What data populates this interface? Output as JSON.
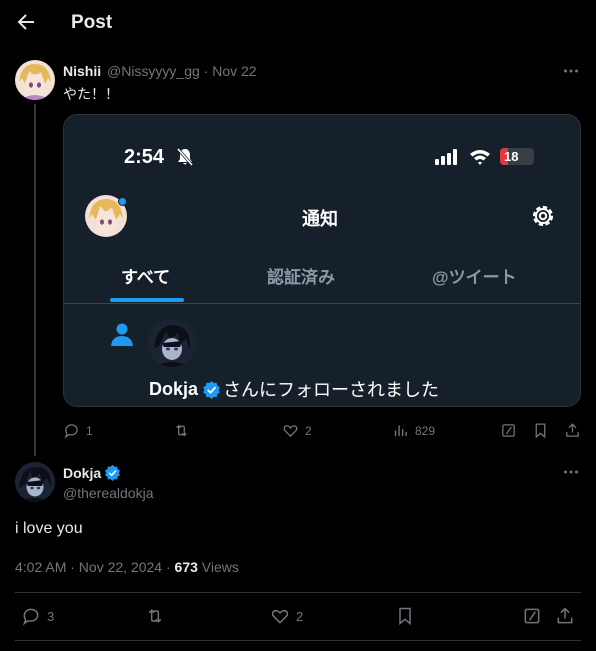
{
  "header": {
    "title": "Post"
  },
  "tweet1": {
    "name": "Nishii",
    "handle": "@Nissyyyy_gg",
    "date": "Nov 22",
    "meta": "@Nissyyyy_gg · Nov 22",
    "text": "やた！！",
    "actions": {
      "replies": "1",
      "retweets": "",
      "likes": "2",
      "views": "829"
    },
    "embed": {
      "time": "2:54",
      "battery": "18",
      "title": "通知",
      "tabs": [
        "すべて",
        "認証済み",
        "@ツイート"
      ],
      "follower_name": "Dokja",
      "follow_text": "さんにフォローされました"
    }
  },
  "tweet2": {
    "name": "Dokja",
    "handle": "@therealdokja",
    "text": "i love you",
    "timestamp": "4:02 AM · Nov 22, 2024 · ",
    "views_count": "673",
    "views_label": " Views",
    "actions": {
      "replies": "3",
      "retweets": "",
      "likes": "2"
    }
  },
  "colors": {
    "accent": "#1d9bf0",
    "card_bg": "#15202b",
    "muted": "#71767b"
  }
}
